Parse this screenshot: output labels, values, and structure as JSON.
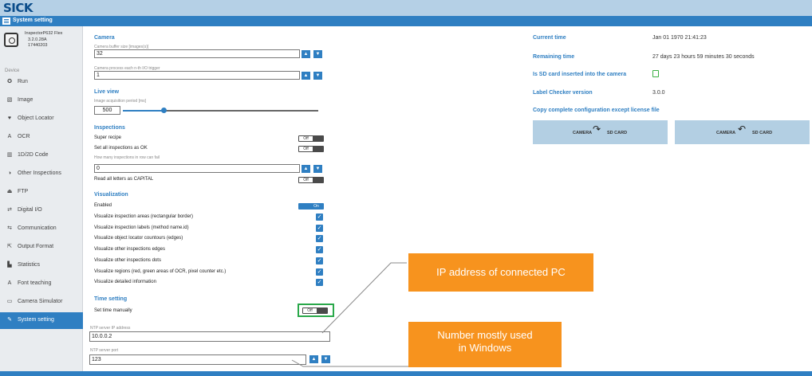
{
  "app": {
    "logo": "SICK",
    "page_title": "System setting"
  },
  "device": {
    "name": "InspectorP632 Flex",
    "version": "3.2.0.28A",
    "serial": "17440203"
  },
  "sidebar": {
    "section_label": "Device",
    "items": [
      {
        "label": "Run",
        "icon": "run-icon",
        "glyph": "✪"
      },
      {
        "label": "Image",
        "icon": "image-icon",
        "glyph": "▧"
      },
      {
        "label": "Object Locator",
        "icon": "object-locator-icon",
        "glyph": "♥"
      },
      {
        "label": "OCR",
        "icon": "ocr-icon",
        "glyph": "A"
      },
      {
        "label": "1D/2D Code",
        "icon": "barcode-icon",
        "glyph": "▥"
      },
      {
        "label": "Other Inspections",
        "icon": "inspections-icon",
        "glyph": "◑"
      },
      {
        "label": "FTP",
        "icon": "ftp-icon",
        "glyph": "⏏"
      },
      {
        "label": "Digital I/O",
        "icon": "digital-io-icon",
        "glyph": "⇄"
      },
      {
        "label": "Communication",
        "icon": "communication-icon",
        "glyph": "⇆"
      },
      {
        "label": "Output Format",
        "icon": "output-format-icon",
        "glyph": "⇱"
      },
      {
        "label": "Statistics",
        "icon": "statistics-icon",
        "glyph": "▙"
      },
      {
        "label": "Font teaching",
        "icon": "font-teaching-icon",
        "glyph": "A"
      },
      {
        "label": "Camera Simulator",
        "icon": "camera-simulator-icon",
        "glyph": "▭"
      },
      {
        "label": "System setting",
        "icon": "wrench-icon",
        "glyph": "✎"
      }
    ],
    "active_index": 13
  },
  "camera": {
    "title": "Camera",
    "buffer_label": "Camera buffer size [images(s)]",
    "buffer_value": "32",
    "process_label": "Camera process each n-th I/O trigger",
    "process_value": "1"
  },
  "live_view": {
    "title": "Live view",
    "period_label": "Image acquisition period [ms]",
    "period_value": "500",
    "slider_fraction": 0.21
  },
  "inspections": {
    "title": "Inspections",
    "super_recipe_label": "Super recipe",
    "super_recipe_state": "Off",
    "set_all_ok_label": "Set all inspections as OK",
    "set_all_ok_state": "Off",
    "fail_label": "How many inspections in row can fail",
    "fail_value": "0",
    "capital_label": "Read all letters as CAPITAL",
    "capital_state": "Off"
  },
  "visualization": {
    "title": "Visualization",
    "enabled_label": "Enabled",
    "enabled_state": "On",
    "options": [
      "Visualize inspection areas (rectangular border)",
      "Visualize inspection labels (method name.id)",
      "Visualize object locator countours (edges)",
      "Visualize other inspections edges",
      "Visualize other inspections dots",
      "Visualize regions (red, green areas of OCR, pixel counter etc.)",
      "Visualize detailed information"
    ]
  },
  "time_setting": {
    "title": "Time setting",
    "manual_label": "Set time manually",
    "manual_state": "Off",
    "ntp_ip_label": "NTP server IP address",
    "ntp_ip_value": "10.0.0.2",
    "ntp_port_label": "NTP server port",
    "ntp_port_value": "123"
  },
  "info": {
    "current_time_label": "Current time",
    "current_time_value": "Jan 01 1970 21:41:23",
    "remaining_label": "Remaining time",
    "remaining_value": "27 days 23 hours 59 minutes 30 seconds",
    "sd_label": "Is SD card inserted into the camera",
    "checker_label": "Label Checker version",
    "checker_value": "3.0.0",
    "copy_label": "Copy complete configuration except license file"
  },
  "copy_buttons": {
    "to_sd": {
      "from": "CAMERA",
      "to": "SD CARD"
    },
    "from_sd": {
      "from": "CAMERA",
      "to": "SD CARD"
    }
  },
  "callouts": {
    "ip": "IP address of connected PC",
    "port_line1": "Number  mostly used",
    "port_line2": "in Windows"
  },
  "colors": {
    "accent": "#2f7fc2",
    "callout": "#f7931e",
    "sd_icon": "#3cb043"
  }
}
